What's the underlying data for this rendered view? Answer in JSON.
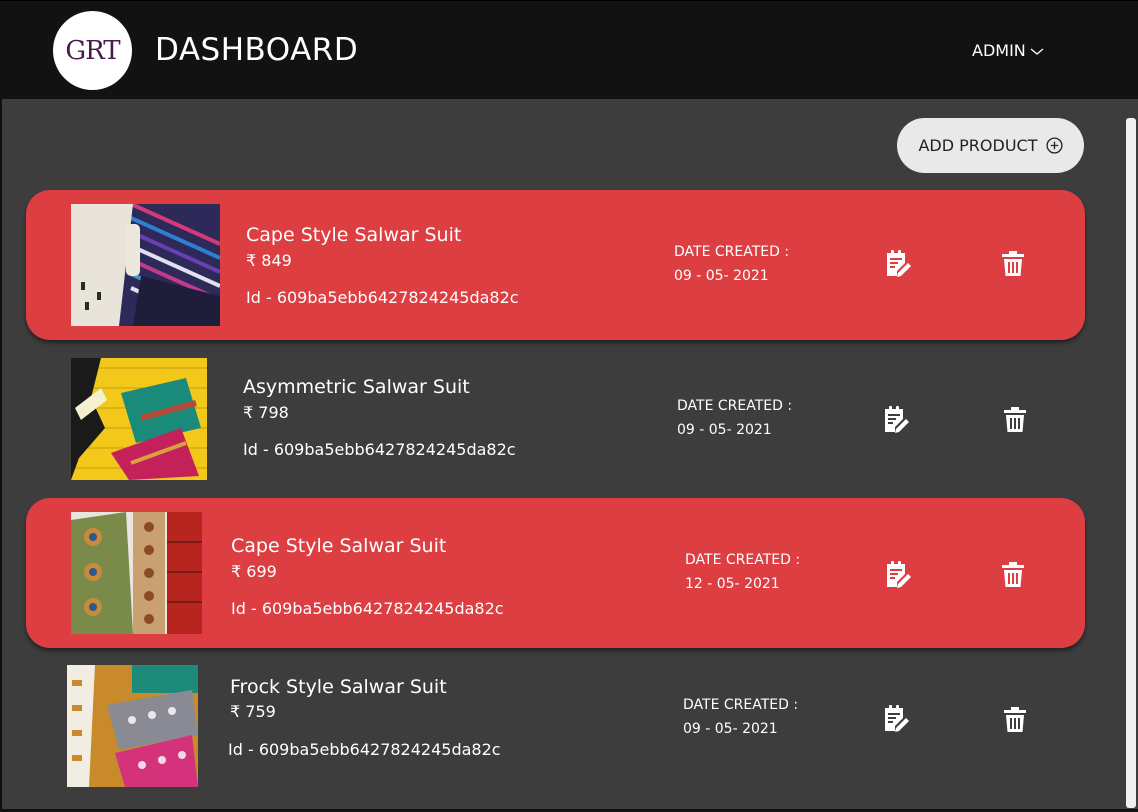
{
  "header": {
    "logo_text": "GRT",
    "title": "DASHBOARD",
    "admin_label": "ADMIN"
  },
  "toolbar": {
    "add_product_label": "ADD PRODUCT"
  },
  "date_label": "DATE CREATED :",
  "products": [
    {
      "name": "Cape Style Salwar Suit",
      "price": "₹ 849",
      "id": "Id - 609ba5ebb6427824245da82c",
      "date": "09 - 05- 2021",
      "highlighted": true
    },
    {
      "name": "Asymmetric Salwar Suit",
      "price": "₹ 798",
      "id": "Id - 609ba5ebb6427824245da82c",
      "date": "09 - 05- 2021",
      "highlighted": false
    },
    {
      "name": "Cape Style Salwar Suit",
      "price": "₹ 699",
      "id": "Id - 609ba5ebb6427824245da82c",
      "date": "12 - 05- 2021",
      "highlighted": true
    },
    {
      "name": "Frock Style Salwar Suit",
      "price": "₹ 759",
      "id": "Id - 609ba5ebb6427824245da82c",
      "date": "09 - 05- 2021",
      "highlighted": false
    }
  ],
  "colors": {
    "header_bg": "#121212",
    "page_bg": "#3d3d3d",
    "highlight_card": "#dc3e42",
    "button_bg": "#e9e9e9"
  },
  "icons": [
    "chevron-down-icon",
    "add-circle-icon",
    "edit-icon",
    "delete-icon"
  ]
}
